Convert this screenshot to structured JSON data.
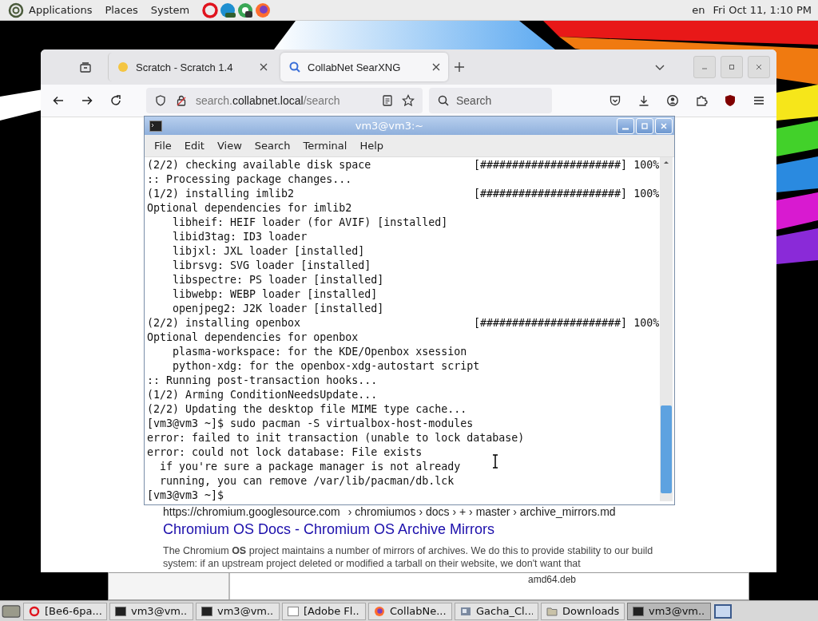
{
  "top_panel": {
    "menus": [
      "Applications",
      "Places",
      "System"
    ],
    "launchers": [
      {
        "kind": "opera"
      },
      {
        "kind": "edge"
      },
      {
        "kind": "chrome"
      },
      {
        "kind": "firefox"
      }
    ],
    "keyboard": "en",
    "clock": "Fri Oct 11, 1:10 PM"
  },
  "browser": {
    "tabs": [
      {
        "title": "Scratch - Scratch 1.4",
        "selected": false,
        "kind": "scratch"
      },
      {
        "title": "CollabNet SearXNG",
        "selected": true,
        "kind": "search"
      }
    ],
    "url": {
      "prefix": "search.",
      "domain": "collabnet.local",
      "path": "/search"
    },
    "search_placeholder": "Search",
    "result": {
      "site": "https://chromium.googlesource.com",
      "breadcrumbs": "› chromiumos › docs › + › master › archive_mirrors.md",
      "title": "Chromium OS Docs - Chromium OS Archive Mirrors",
      "snippet": "The Chromium **OS** project maintains a number of mirrors of archives. We do this to provide stability to our build system: if an upstream project deleted or modified a tarball on their website, we don't want that"
    }
  },
  "terminal": {
    "title": "vm3@vm3:~",
    "menu": [
      "File",
      "Edit",
      "View",
      "Search",
      "Terminal",
      "Help"
    ],
    "lines": [
      {
        "text": "(2/2) checking available disk space",
        "progress": "[######################] 100%"
      },
      {
        "text": ":: Processing package changes..."
      },
      {
        "text": "(1/2) installing imlib2",
        "progress": "[######################] 100%"
      },
      {
        "text": "Optional dependencies for imlib2"
      },
      {
        "text": "    libheif: HEIF loader (for AVIF) [installed]"
      },
      {
        "text": "    libid3tag: ID3 loader"
      },
      {
        "text": "    libjxl: JXL loader [installed]"
      },
      {
        "text": "    librsvg: SVG loader [installed]"
      },
      {
        "text": "    libspectre: PS loader [installed]"
      },
      {
        "text": "    libwebp: WEBP loader [installed]"
      },
      {
        "text": "    openjpeg2: J2K loader [installed]"
      },
      {
        "text": "(2/2) installing openbox",
        "progress": "[######################] 100%"
      },
      {
        "text": "Optional dependencies for openbox"
      },
      {
        "text": "    plasma-workspace: for the KDE/Openbox xsession"
      },
      {
        "text": "    python-xdg: for the openbox-xdg-autostart script"
      },
      {
        "text": ":: Running post-transaction hooks..."
      },
      {
        "text": "(1/2) Arming ConditionNeedsUpdate..."
      },
      {
        "text": "(2/2) Updating the desktop file MIME type cache..."
      },
      {
        "text": "[vm3@vm3 ~]$ sudo pacman -S virtualbox-host-modules"
      },
      {
        "text": "error: failed to init transaction (unable to lock database)"
      },
      {
        "text": "error: could not lock database: File exists"
      },
      {
        "text": "  if you're sure a package manager is not already"
      },
      {
        "text": "  running, you can remove /var/lib/pacman/db.lck"
      },
      {
        "text": "[vm3@vm3 ~]$ "
      }
    ]
  },
  "file_window": {
    "file_label": "amd64.deb"
  },
  "taskbar": [
    {
      "label": "[Ве6-6ра...",
      "kind": "opera",
      "selected": false
    },
    {
      "label": "vm3@vm...",
      "kind": "terminal",
      "selected": false
    },
    {
      "label": "vm3@vm...",
      "kind": "terminal",
      "selected": false
    },
    {
      "label": "[Adobe Fl...",
      "kind": "window",
      "selected": false
    },
    {
      "label": "CollabNe...",
      "kind": "firefox",
      "selected": false
    },
    {
      "label": "Gacha_Cl...",
      "kind": "app",
      "selected": false
    },
    {
      "label": "Downloads",
      "kind": "folder",
      "selected": false
    },
    {
      "label": "vm3@vm...",
      "kind": "terminal",
      "selected": true
    }
  ]
}
